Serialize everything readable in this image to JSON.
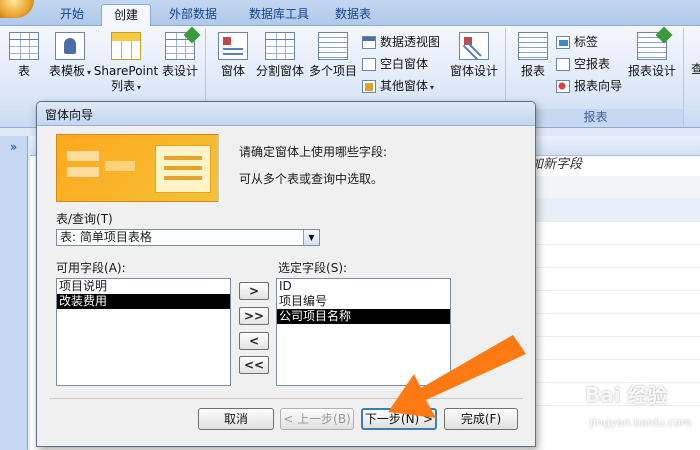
{
  "ribbon": {
    "tabs": [
      {
        "label": "开始",
        "active": false
      },
      {
        "label": "创建",
        "active": true
      },
      {
        "label": "外部数据",
        "active": false
      },
      {
        "label": "数据库工具",
        "active": false
      },
      {
        "label": "数据表",
        "active": false
      }
    ],
    "tables_group": {
      "table": "表",
      "table_template": "表模板",
      "sharepoint_list": "SharePoint",
      "sharepoint_list_line2": "列表",
      "table_design": "表设计"
    },
    "forms_group": {
      "form": "窗体",
      "split_form": "分割窗体",
      "multiple_items": "多个项目",
      "pivot_chart": "数据透视图",
      "blank_form": "空白窗体",
      "more_forms": "其他窗体",
      "form_design": "窗体设计"
    },
    "reports_group": {
      "label": "报表",
      "report": "报表",
      "labels": "标签",
      "blank_report": "空报表",
      "report_wizard": "报表向导",
      "report_design": "报表设计",
      "next_group_partial": "查"
    }
  },
  "nav_toggle": "»",
  "sheet": {
    "column_header": "加新字段"
  },
  "dialog": {
    "title": "窗体向导",
    "prompt_line1": "请确定窗体上使用哪些字段:",
    "prompt_line2": "可从多个表或查询中选取。",
    "table_query_label": "表/查询",
    "table_query_key": "(T)",
    "table_query_value": "表: 简单项目表格",
    "available_label": "可用字段",
    "available_key": "(A):",
    "available_fields": [
      {
        "text": "项目说明",
        "selected": false
      },
      {
        "text": "改装费用",
        "selected": true
      }
    ],
    "selected_label": "选定字段",
    "selected_key": "(S):",
    "selected_fields": [
      {
        "text": "ID",
        "selected": false
      },
      {
        "text": "项目编号",
        "selected": false
      },
      {
        "text": "公司项目名称",
        "selected": true
      }
    ],
    "move_buttons": [
      ">",
      ">>",
      "<",
      "<<"
    ],
    "buttons": {
      "cancel": "取消",
      "back": "< 上一步(B)",
      "next": "下一步(N) >",
      "finish": "完成(F)"
    }
  },
  "watermark": {
    "brand": "Bai 经验",
    "url": "jingyan.baidu.com"
  },
  "colors": {
    "arrow": "#ff7a12",
    "ribbon_bg": "#dbe7f7",
    "dialog_bg": "#f0f0f0"
  },
  "icons": [
    "office-orb-icon",
    "table-icon",
    "table-template-icon",
    "sharepoint-list-icon",
    "table-design-icon",
    "form-icon",
    "split-form-icon",
    "multiple-items-icon",
    "pivot-chart-icon",
    "blank-form-icon",
    "more-forms-icon",
    "form-design-icon",
    "report-icon",
    "labels-icon",
    "blank-report-icon",
    "report-wizard-icon",
    "report-design-icon",
    "dropdown-arrow-icon",
    "annotation-arrow-icon"
  ]
}
